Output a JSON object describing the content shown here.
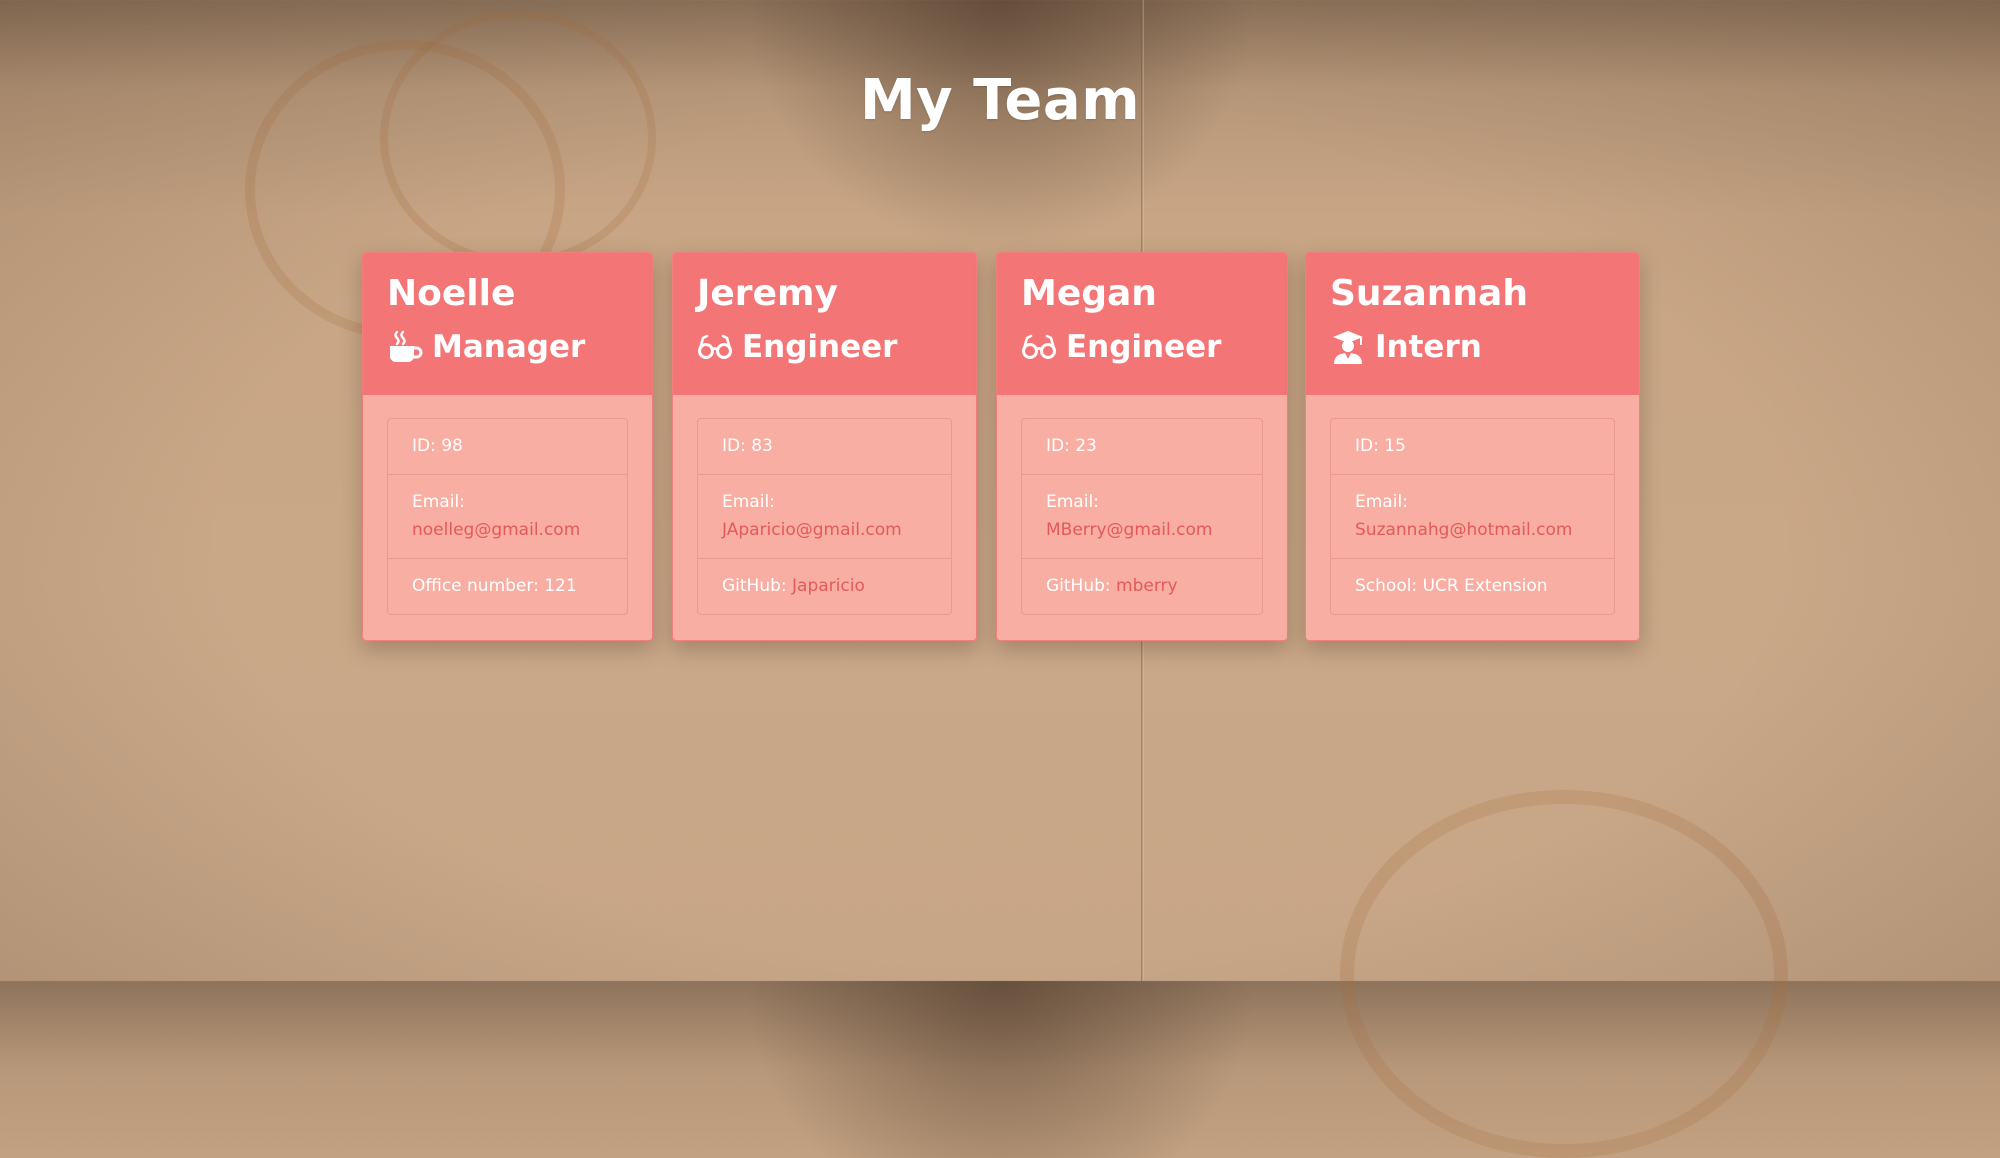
{
  "page": {
    "title": "My Team"
  },
  "colors": {
    "header": "#f37575",
    "card_body": "#f8aea2",
    "link": "#e45a5a",
    "text": "#ffffff"
  },
  "team": [
    {
      "name": "Noelle",
      "role": "Manager",
      "icon": "coffee-icon",
      "id_text": "ID: 98",
      "email_label": "Email:",
      "email": "noelleg@gmail.com",
      "extra_label": "Office number: 121",
      "extra_link": ""
    },
    {
      "name": "Jeremy",
      "role": "Engineer",
      "icon": "glasses-icon",
      "id_text": "ID: 83",
      "email_label": "Email:",
      "email": "JAparicio@gmail.com",
      "extra_label": "GitHub: ",
      "extra_link": "Japaricio"
    },
    {
      "name": "Megan",
      "role": "Engineer",
      "icon": "glasses-icon",
      "id_text": "ID: 23",
      "email_label": "Email:",
      "email": "MBerry@gmail.com",
      "extra_label": "GitHub: ",
      "extra_link": "mberry"
    },
    {
      "name": "Suzannah",
      "role": "Intern",
      "icon": "graduate-icon",
      "id_text": "ID: 15",
      "email_label": "Email:",
      "email": "Suzannahg@hotmail.com",
      "extra_label": "School: UCR Extension",
      "extra_link": ""
    }
  ]
}
